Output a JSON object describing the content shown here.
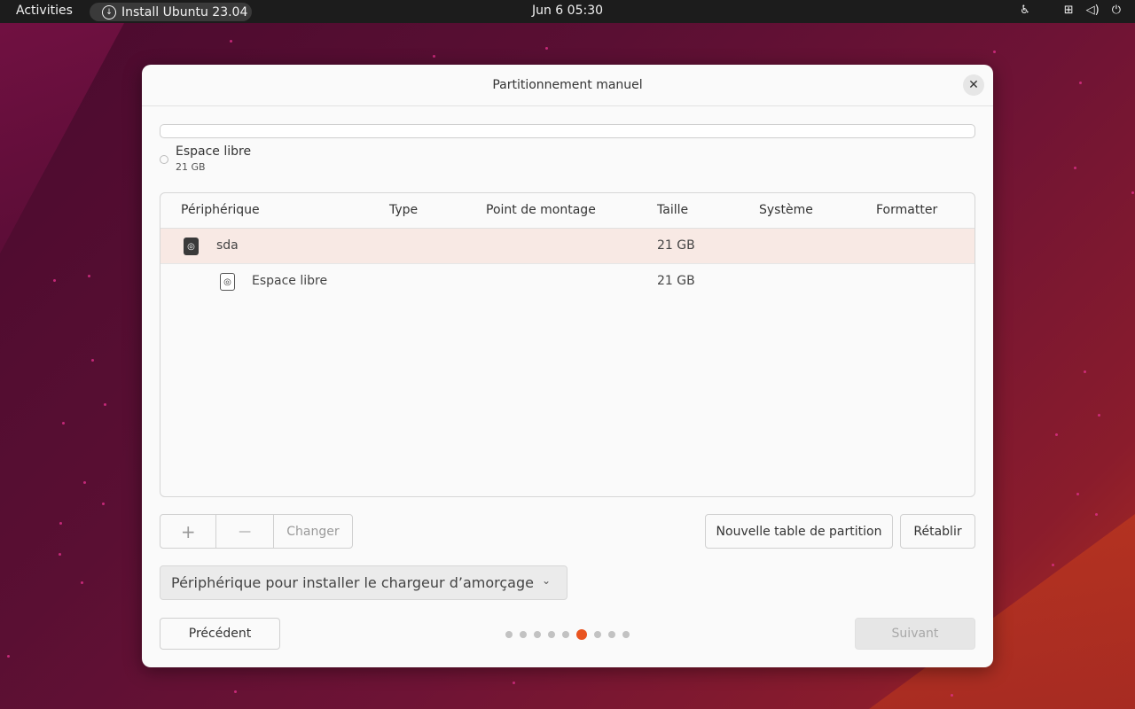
{
  "topbar": {
    "activities": "Activities",
    "app_label": "Install Ubuntu 23.04",
    "clock": "Jun 6  05:30"
  },
  "dialog": {
    "title": "Partitionnement manuel",
    "legend": {
      "name": "Espace libre",
      "size": "21 GB"
    },
    "table": {
      "headers": [
        "Périphérique",
        "Type",
        "Point de montage",
        "Taille",
        "Système",
        "Formatter"
      ],
      "rows": [
        {
          "device": "sda",
          "size": "21 GB",
          "selected": true
        },
        {
          "device": "Espace libre",
          "size": "21 GB",
          "selected": false
        }
      ]
    },
    "buttons": {
      "add": "+",
      "remove": "—",
      "change": "Changer",
      "new_table": "Nouvelle table de partition",
      "revert": "Rétablir",
      "back": "Précédent",
      "next": "Suivant"
    },
    "boot_device_placeholder": "Périphérique pour installer le chargeur d’amorçage",
    "pager": {
      "total": 9,
      "current": 6
    }
  },
  "colors": {
    "accent": "#e95420",
    "selected_row": "#f8e9e4"
  }
}
